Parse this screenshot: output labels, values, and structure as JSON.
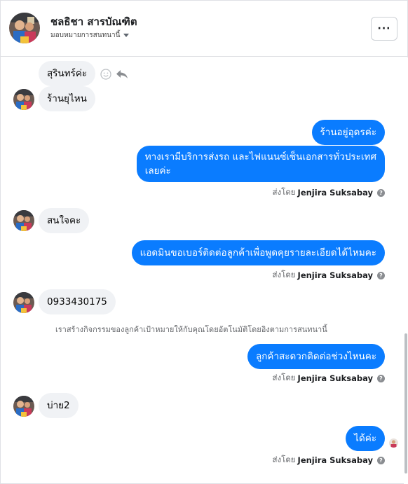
{
  "header": {
    "contact_name": "ชลธิชา สารบัณฑิต",
    "assign_label": "มอบหมายการสนทนานี้",
    "more_label": "···"
  },
  "messages": [
    {
      "side": "in",
      "text": "สุรินทร์ค่ะ"
    },
    {
      "side": "in",
      "text": "ร้านยุไหน"
    },
    {
      "side": "out",
      "text": "ร้านอยู่อุดรค่ะ"
    },
    {
      "side": "out",
      "line1": "ทางเรามีบริการส่งรถ และไฟแนนซ์เซ็นเอกสารทั่วประเทศ",
      "line2": "เลยค่ะ"
    },
    {
      "side": "in",
      "text": "สนใจคะ"
    },
    {
      "side": "out",
      "text": "แอดมินขอเบอร์ติดต่อลูกค้าเพื่อพูดคุยรายละเอียดได้ไหมคะ"
    },
    {
      "side": "in",
      "text": "0933430175"
    },
    {
      "side": "out",
      "text": "ลูกค้าสะดวกติดต่อช่วงไหนคะ"
    },
    {
      "side": "in",
      "text": "บ่าย2"
    },
    {
      "side": "out",
      "text": "ได้ค่ะ"
    }
  ],
  "sent_by": {
    "prefix": "ส่งโดย",
    "agent": "Jenjira Suksabay",
    "help": "?"
  },
  "system_note": "เราสร้างกิจกรรมของลูกค้าเป้าหมายให้กับคุณโดยอัตโนมัติโดยอิงตามการสนทนานี้",
  "colors": {
    "outgoing_bubble": "#0a7cff",
    "incoming_bubble": "#f0f2f5"
  },
  "icons": {
    "react": "smiley-icon",
    "reply": "reply-arrow-icon",
    "help": "question-circle-icon"
  }
}
